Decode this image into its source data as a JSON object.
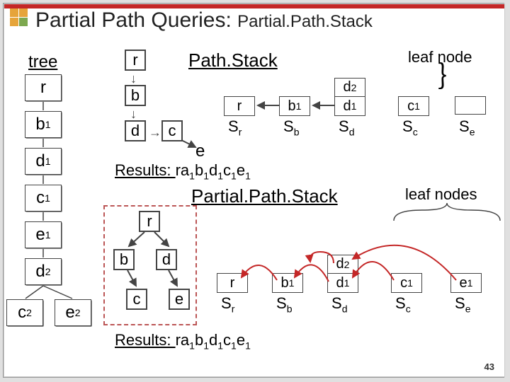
{
  "title_main": "Partial Path Queries: ",
  "title_sub": "Partial.Path.Stack",
  "tree_header": "tree",
  "tree_nodes": {
    "r": "r",
    "b1": "b",
    "b1s": "1",
    "d1": "d",
    "d1s": "1",
    "c1": "c",
    "c1s": "1",
    "e1": "e",
    "e1s": "1",
    "d2": "d",
    "d2s": "2",
    "c2": "c",
    "c2s": "2",
    "e2": "e",
    "e2s": "2"
  },
  "pathstack_label": "Path.Stack",
  "leaf_node_label": "leaf node",
  "leaf_nodes_label": "leaf nodes",
  "q1": {
    "r": "r",
    "b": "b",
    "d": "d",
    "c": "c",
    "e": "e"
  },
  "q2": {
    "r": "r",
    "b": "b",
    "d": "d",
    "c": "c",
    "e": "e"
  },
  "stacks1": {
    "Sr": {
      "rows": [
        "r"
      ],
      "label": "S",
      "sub": "r"
    },
    "Sb": {
      "rows": [
        "b"
      ],
      "bsub": "1",
      "label": "S",
      "sub": "b"
    },
    "Sd": {
      "rows": [
        "d",
        "d"
      ],
      "dsub2": "2",
      "dsub1": "1",
      "label": "S",
      "sub": "d"
    },
    "Sc": {
      "rows": [
        "c"
      ],
      "csub": "1",
      "label": "S",
      "sub": "c"
    },
    "Se": {
      "rows": [
        ""
      ],
      "label": "S",
      "sub": "e"
    }
  },
  "stacks2": {
    "Sr": {
      "rows": [
        "r"
      ],
      "label": "S",
      "sub": "r"
    },
    "Sb": {
      "rows": [
        "b"
      ],
      "bsub": "1",
      "label": "S",
      "sub": "b"
    },
    "Sd": {
      "rows": [
        "d",
        "d"
      ],
      "dsub2": "2",
      "dsub1": "1",
      "label": "S",
      "sub": "d"
    },
    "Sc": {
      "rows": [
        "c"
      ],
      "csub": "1",
      "label": "S",
      "sub": "c"
    },
    "Se": {
      "rows": [
        "e"
      ],
      "esub": "1",
      "label": "S",
      "sub": "e"
    }
  },
  "pps_label": "Partial.Path.Stack",
  "results_label": "Results: ",
  "results_val": "ra",
  "res_parts": [
    "r",
    "a",
    "b",
    "d",
    "c",
    "e"
  ],
  "res_subs": [
    "1",
    "1",
    "1",
    "1",
    "1"
  ],
  "pagenum": "43"
}
